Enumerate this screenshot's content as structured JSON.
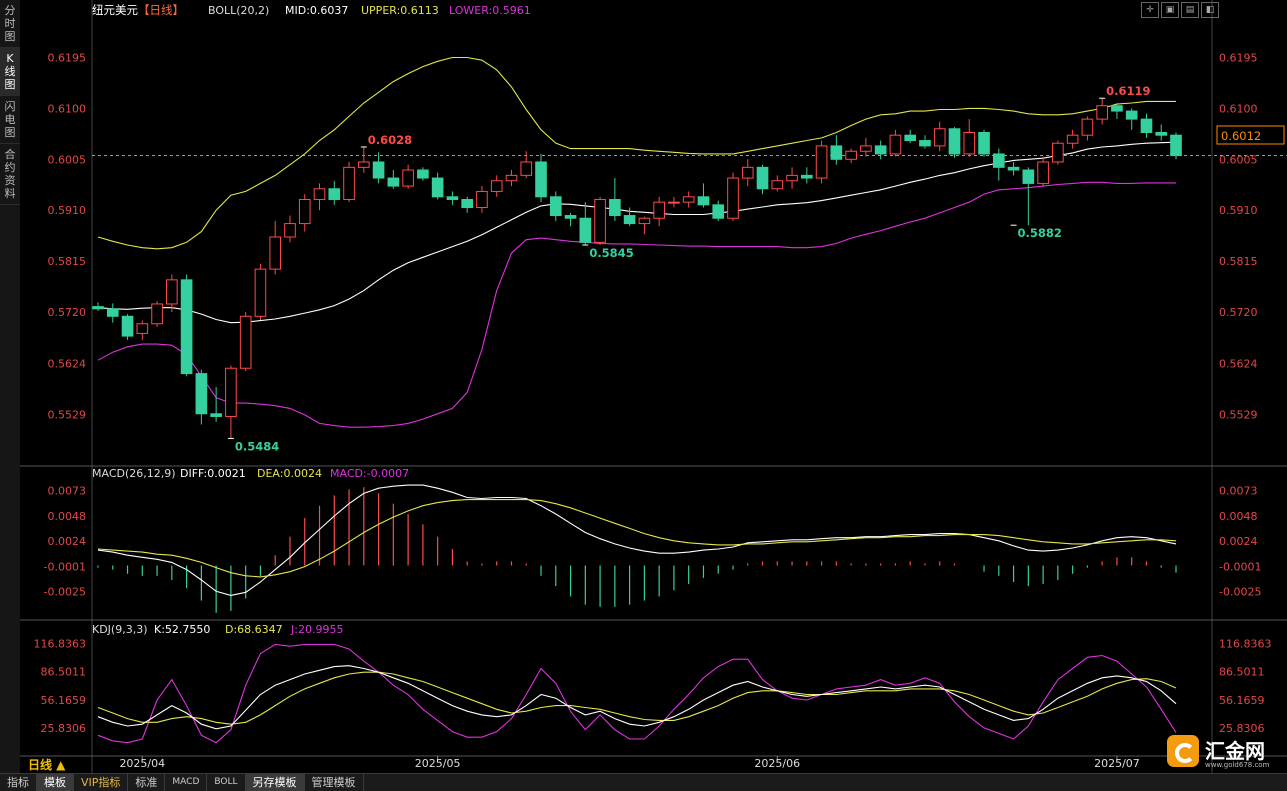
{
  "sidebar": {
    "items": [
      "分时图",
      "K线图",
      "闪电图",
      "合约资料"
    ],
    "active_index": 1
  },
  "header": {
    "symbol": "纽元美元",
    "period_tag": "【日线】",
    "boll_label": "BOLL(20,2)",
    "mid": "MID:0.6037",
    "upper": "UPPER:0.6113",
    "lower": "LOWER:0.5961"
  },
  "macd_header": {
    "name": "MACD(26,12,9)",
    "diff": "DIFF:0.0021",
    "dea": "DEA:0.0024",
    "macd": "MACD:-0.0007"
  },
  "kdj_header": {
    "name": "KDJ(9,3,3)",
    "k": "K:52.7550",
    "d": "D:68.6347",
    "j": "J:20.9955"
  },
  "current_price": "0.6012",
  "period_button": "日线 ▲",
  "bottom_tabs": [
    "指标",
    "模板",
    "VIP指标",
    "标准",
    "MACD",
    "BOLL",
    "另存模板",
    "管理模板"
  ],
  "logo": {
    "name": "汇金网",
    "url": "www.gold678.com"
  },
  "colors": {
    "up": "#ff4a4a",
    "down": "#35d0a0",
    "mid": "#ffffff",
    "upper": "#e5e54a",
    "lower": "#dd33dd",
    "axis_label": "#e04848",
    "dea": "#e5e54a"
  },
  "chart_data": {
    "type": "candlestick",
    "title": "纽元美元 日线",
    "x_ticks": [
      "2025/04",
      "2025/05",
      "2025/06",
      "2025/07"
    ],
    "price_axis": {
      "ticks": [
        0.6195,
        0.61,
        0.6005,
        0.591,
        0.5815,
        0.572,
        0.5624,
        0.5529
      ],
      "range": [
        0.544,
        0.6265
      ]
    },
    "annotations": [
      {
        "label": "0.6028",
        "kind": "high",
        "index": 18,
        "value": 0.6028
      },
      {
        "label": "0.5484",
        "kind": "low",
        "index": 9,
        "value": 0.5484
      },
      {
        "label": "0.5845",
        "kind": "low",
        "index": 33,
        "value": 0.5845
      },
      {
        "label": "0.5882",
        "kind": "low",
        "index": 62,
        "value": 0.5882
      },
      {
        "label": "0.6119",
        "kind": "high",
        "index": 68,
        "value": 0.6119
      }
    ],
    "candles": [
      [
        0.573,
        0.5738,
        0.5722,
        0.5726
      ],
      [
        0.5726,
        0.5736,
        0.57,
        0.5712
      ],
      [
        0.5712,
        0.5716,
        0.5668,
        0.5675
      ],
      [
        0.568,
        0.5704,
        0.5668,
        0.5698
      ],
      [
        0.5698,
        0.574,
        0.5692,
        0.5735
      ],
      [
        0.5735,
        0.579,
        0.572,
        0.578
      ],
      [
        0.578,
        0.579,
        0.56,
        0.5605
      ],
      [
        0.5605,
        0.5612,
        0.551,
        0.553
      ],
      [
        0.553,
        0.558,
        0.5515,
        0.5525
      ],
      [
        0.5525,
        0.562,
        0.5484,
        0.5615
      ],
      [
        0.5615,
        0.572,
        0.561,
        0.5712
      ],
      [
        0.5712,
        0.581,
        0.5705,
        0.58
      ],
      [
        0.58,
        0.589,
        0.579,
        0.586
      ],
      [
        0.586,
        0.59,
        0.585,
        0.5885
      ],
      [
        0.5885,
        0.594,
        0.587,
        0.593
      ],
      [
        0.593,
        0.596,
        0.591,
        0.595
      ],
      [
        0.595,
        0.5965,
        0.592,
        0.593
      ],
      [
        0.593,
        0.6,
        0.5925,
        0.599
      ],
      [
        0.599,
        0.6028,
        0.598,
        0.6
      ],
      [
        0.6,
        0.6018,
        0.596,
        0.597
      ],
      [
        0.597,
        0.5985,
        0.595,
        0.5955
      ],
      [
        0.5955,
        0.5995,
        0.595,
        0.5985
      ],
      [
        0.5985,
        0.599,
        0.5965,
        0.597
      ],
      [
        0.597,
        0.598,
        0.593,
        0.5935
      ],
      [
        0.5935,
        0.5945,
        0.592,
        0.593
      ],
      [
        0.593,
        0.5935,
        0.5905,
        0.5915
      ],
      [
        0.5915,
        0.5955,
        0.5905,
        0.5945
      ],
      [
        0.5945,
        0.5975,
        0.5935,
        0.5965
      ],
      [
        0.5965,
        0.5985,
        0.5955,
        0.5975
      ],
      [
        0.5975,
        0.602,
        0.597,
        0.6
      ],
      [
        0.6,
        0.6015,
        0.5925,
        0.5935
      ],
      [
        0.5935,
        0.5945,
        0.589,
        0.59
      ],
      [
        0.59,
        0.5905,
        0.588,
        0.5895
      ],
      [
        0.5895,
        0.5925,
        0.5845,
        0.585
      ],
      [
        0.585,
        0.5935,
        0.5845,
        0.593
      ],
      [
        0.593,
        0.597,
        0.589,
        0.59
      ],
      [
        0.59,
        0.5915,
        0.588,
        0.5885
      ],
      [
        0.5885,
        0.5898,
        0.5865,
        0.5895
      ],
      [
        0.5895,
        0.5935,
        0.588,
        0.5925
      ],
      [
        0.5925,
        0.5935,
        0.5915,
        0.5925
      ],
      [
        0.5925,
        0.5945,
        0.5915,
        0.5935
      ],
      [
        0.5935,
        0.596,
        0.5915,
        0.592
      ],
      [
        0.592,
        0.5928,
        0.589,
        0.5895
      ],
      [
        0.5895,
        0.598,
        0.589,
        0.597
      ],
      [
        0.597,
        0.6005,
        0.5955,
        0.599
      ],
      [
        0.599,
        0.5995,
        0.594,
        0.595
      ],
      [
        0.595,
        0.5975,
        0.5945,
        0.5965
      ],
      [
        0.5965,
        0.599,
        0.595,
        0.5975
      ],
      [
        0.5975,
        0.599,
        0.596,
        0.597
      ],
      [
        0.597,
        0.604,
        0.596,
        0.603
      ],
      [
        0.603,
        0.605,
        0.5995,
        0.6005
      ],
      [
        0.6005,
        0.6025,
        0.5998,
        0.602
      ],
      [
        0.602,
        0.6045,
        0.601,
        0.603
      ],
      [
        0.603,
        0.604,
        0.6005,
        0.6015
      ],
      [
        0.6015,
        0.606,
        0.601,
        0.605
      ],
      [
        0.605,
        0.606,
        0.6035,
        0.604
      ],
      [
        0.604,
        0.605,
        0.6025,
        0.603
      ],
      [
        0.603,
        0.6075,
        0.602,
        0.6062
      ],
      [
        0.6062,
        0.6065,
        0.6008,
        0.6015
      ],
      [
        0.6015,
        0.608,
        0.601,
        0.6055
      ],
      [
        0.6055,
        0.606,
        0.601,
        0.6015
      ],
      [
        0.6015,
        0.6025,
        0.5965,
        0.599
      ],
      [
        0.599,
        0.6,
        0.5975,
        0.5985
      ],
      [
        0.5985,
        0.599,
        0.5882,
        0.596
      ],
      [
        0.596,
        0.601,
        0.5955,
        0.6
      ],
      [
        0.6,
        0.604,
        0.5995,
        0.6035
      ],
      [
        0.6035,
        0.606,
        0.6025,
        0.605
      ],
      [
        0.605,
        0.6085,
        0.604,
        0.608
      ],
      [
        0.608,
        0.6119,
        0.607,
        0.6105
      ],
      [
        0.6105,
        0.611,
        0.608,
        0.6095
      ],
      [
        0.6095,
        0.61,
        0.606,
        0.608
      ],
      [
        0.608,
        0.609,
        0.6045,
        0.6055
      ],
      [
        0.6055,
        0.607,
        0.604,
        0.605
      ],
      [
        0.605,
        0.6055,
        0.6005,
        0.6012
      ]
    ],
    "boll": {
      "mid": [
        0.5728,
        0.5726,
        0.5725,
        0.5727,
        0.5728,
        0.5728,
        0.5724,
        0.5716,
        0.5706,
        0.57,
        0.5701,
        0.5704,
        0.5707,
        0.5712,
        0.5718,
        0.5724,
        0.5732,
        0.5744,
        0.576,
        0.578,
        0.5798,
        0.5812,
        0.5822,
        0.5832,
        0.5842,
        0.5852,
        0.5864,
        0.5878,
        0.5892,
        0.5906,
        0.5918,
        0.5922,
        0.5921,
        0.5918,
        0.5915,
        0.5912,
        0.5908,
        0.5906,
        0.5904,
        0.5902,
        0.5902,
        0.5902,
        0.5905,
        0.5908,
        0.5912,
        0.5916,
        0.592,
        0.5922,
        0.5924,
        0.5928,
        0.5933,
        0.5938,
        0.5943,
        0.5948,
        0.5955,
        0.5962,
        0.5968,
        0.5975,
        0.598,
        0.5987,
        0.5993,
        0.5998,
        0.6003,
        0.6005,
        0.6007,
        0.6012,
        0.6017,
        0.6024,
        0.6028,
        0.603,
        0.6033,
        0.6035,
        0.6036,
        0.6037
      ],
      "upper": [
        0.586,
        0.5852,
        0.5845,
        0.584,
        0.5838,
        0.584,
        0.585,
        0.587,
        0.591,
        0.5938,
        0.5945,
        0.596,
        0.5975,
        0.5995,
        0.6015,
        0.604,
        0.606,
        0.6085,
        0.611,
        0.613,
        0.615,
        0.6165,
        0.6178,
        0.6188,
        0.6195,
        0.6195,
        0.619,
        0.6172,
        0.614,
        0.6098,
        0.606,
        0.6035,
        0.6025,
        0.6025,
        0.6025,
        0.6025,
        0.6025,
        0.6022,
        0.602,
        0.6018,
        0.6016,
        0.6015,
        0.6015,
        0.6015,
        0.602,
        0.6025,
        0.603,
        0.6035,
        0.604,
        0.6045,
        0.6055,
        0.6068,
        0.608,
        0.6088,
        0.609,
        0.6095,
        0.6095,
        0.6098,
        0.6098,
        0.61,
        0.61,
        0.6098,
        0.6095,
        0.609,
        0.6088,
        0.6088,
        0.609,
        0.6095,
        0.61,
        0.6108,
        0.611,
        0.6113,
        0.6113,
        0.6113
      ],
      "lower": [
        0.563,
        0.5645,
        0.5655,
        0.566,
        0.566,
        0.5658,
        0.564,
        0.56,
        0.556,
        0.555,
        0.555,
        0.5548,
        0.5545,
        0.554,
        0.5528,
        0.5512,
        0.5508,
        0.5505,
        0.5505,
        0.5506,
        0.5508,
        0.5512,
        0.552,
        0.553,
        0.554,
        0.557,
        0.565,
        0.576,
        0.583,
        0.5855,
        0.5858,
        0.5855,
        0.5852,
        0.585,
        0.5848,
        0.5847,
        0.5847,
        0.5846,
        0.5845,
        0.5844,
        0.5843,
        0.5843,
        0.5842,
        0.5842,
        0.5842,
        0.5842,
        0.5842,
        0.584,
        0.584,
        0.5842,
        0.5848,
        0.5858,
        0.5865,
        0.5872,
        0.588,
        0.5888,
        0.5895,
        0.5905,
        0.5915,
        0.5925,
        0.594,
        0.5948,
        0.595,
        0.5952,
        0.5955,
        0.5958,
        0.596,
        0.5962,
        0.5962,
        0.596,
        0.596,
        0.5961,
        0.5961,
        0.5961
      ]
    },
    "macd": {
      "y_ticks": [
        0.0073,
        0.0048,
        0.0024,
        -0.0001,
        -0.0025
      ],
      "range": [
        -0.0048,
        0.0082
      ],
      "diff": [
        0.0015,
        0.0013,
        0.001,
        0.0008,
        0.0006,
        0.0003,
        -0.0004,
        -0.0014,
        -0.0025,
        -0.0029,
        -0.0026,
        -0.0016,
        -0.0004,
        0.0008,
        0.0022,
        0.0035,
        0.0048,
        0.006,
        0.007,
        0.0075,
        0.0077,
        0.0078,
        0.0078,
        0.0075,
        0.0071,
        0.0066,
        0.0065,
        0.0066,
        0.0066,
        0.0065,
        0.0058,
        0.005,
        0.0041,
        0.0032,
        0.0026,
        0.0021,
        0.0017,
        0.0014,
        0.0012,
        0.0012,
        0.0013,
        0.0015,
        0.0016,
        0.0018,
        0.0022,
        0.0023,
        0.0024,
        0.0025,
        0.0025,
        0.0026,
        0.0027,
        0.0027,
        0.0028,
        0.0028,
        0.0029,
        0.003,
        0.003,
        0.0031,
        0.0031,
        0.003,
        0.0027,
        0.0024,
        0.0019,
        0.0015,
        0.0014,
        0.0015,
        0.0017,
        0.002,
        0.0024,
        0.0027,
        0.0028,
        0.0027,
        0.0024,
        0.0021
      ],
      "dea": [
        0.0016,
        0.0015,
        0.0014,
        0.0013,
        0.0011,
        0.001,
        0.0007,
        0.0003,
        -0.0002,
        -0.0007,
        -0.001,
        -0.0011,
        -0.0009,
        -0.0006,
        -0.0001,
        0.0006,
        0.0014,
        0.0023,
        0.0032,
        0.004,
        0.0047,
        0.0053,
        0.0058,
        0.0061,
        0.0063,
        0.0064,
        0.0064,
        0.0064,
        0.0064,
        0.0064,
        0.0063,
        0.006,
        0.0056,
        0.0051,
        0.0046,
        0.0041,
        0.0036,
        0.0031,
        0.0027,
        0.0024,
        0.0022,
        0.0021,
        0.002,
        0.002,
        0.0021,
        0.0021,
        0.0022,
        0.0023,
        0.0023,
        0.0024,
        0.0025,
        0.0026,
        0.0027,
        0.0027,
        0.0028,
        0.0028,
        0.0029,
        0.0029,
        0.003,
        0.003,
        0.003,
        0.0029,
        0.0027,
        0.0025,
        0.0023,
        0.0022,
        0.0021,
        0.0021,
        0.0022,
        0.0023,
        0.0024,
        0.0025,
        0.0025,
        0.0024
      ],
      "hist": [
        -0.0002,
        -0.0004,
        -0.0008,
        -0.001,
        -0.001,
        -0.0014,
        -0.0022,
        -0.0034,
        -0.0046,
        -0.0044,
        -0.0032,
        -0.001,
        0.001,
        0.0028,
        0.0046,
        0.0058,
        0.0068,
        0.0074,
        0.0076,
        0.007,
        0.006,
        0.005,
        0.004,
        0.0028,
        0.0016,
        0.0004,
        0.0002,
        0.0004,
        0.0004,
        0.0002,
        -0.001,
        -0.002,
        -0.003,
        -0.0038,
        -0.004,
        -0.004,
        -0.0038,
        -0.0034,
        -0.003,
        -0.0024,
        -0.0018,
        -0.0012,
        -0.0008,
        -0.0004,
        0.0002,
        0.0004,
        0.0004,
        0.0004,
        0.0004,
        0.0004,
        0.0004,
        0.0002,
        0.0002,
        0.0002,
        0.0002,
        0.0004,
        0.0002,
        0.0004,
        0.0002,
        0.0,
        -0.0006,
        -0.001,
        -0.0016,
        -0.002,
        -0.0018,
        -0.0014,
        -0.0008,
        -0.0002,
        0.0004,
        0.0008,
        0.0008,
        0.0004,
        -0.0002,
        -0.0007
      ]
    },
    "kdj": {
      "y_ticks": [
        116.8363,
        86.5011,
        56.1659,
        25.8306
      ],
      "range": [
        0,
        125
      ],
      "k": [
        38,
        32,
        28,
        30,
        40,
        50,
        42,
        30,
        25,
        28,
        45,
        62,
        72,
        78,
        84,
        88,
        92,
        93,
        90,
        86,
        80,
        74,
        66,
        58,
        50,
        44,
        40,
        38,
        40,
        50,
        62,
        58,
        48,
        40,
        44,
        36,
        30,
        28,
        32,
        38,
        46,
        56,
        64,
        72,
        76,
        70,
        66,
        62,
        60,
        62,
        64,
        66,
        68,
        70,
        68,
        70,
        72,
        70,
        62,
        54,
        46,
        40,
        34,
        36,
        46,
        58,
        66,
        74,
        80,
        82,
        80,
        76,
        66,
        52
      ],
      "d": [
        48,
        42,
        36,
        32,
        32,
        36,
        38,
        36,
        32,
        30,
        32,
        40,
        50,
        60,
        68,
        74,
        80,
        84,
        86,
        86,
        84,
        80,
        76,
        70,
        64,
        58,
        52,
        46,
        42,
        44,
        48,
        50,
        50,
        48,
        46,
        42,
        38,
        35,
        34,
        34,
        38,
        44,
        50,
        58,
        64,
        66,
        66,
        64,
        62,
        62,
        62,
        64,
        66,
        66,
        66,
        68,
        68,
        68,
        66,
        62,
        56,
        50,
        44,
        40,
        42,
        48,
        54,
        60,
        68,
        74,
        78,
        79,
        76,
        69
      ],
      "j": [
        18,
        12,
        10,
        14,
        56,
        78,
        50,
        18,
        10,
        24,
        72,
        106,
        116,
        114,
        116,
        116,
        116,
        111,
        98,
        86,
        72,
        62,
        46,
        34,
        22,
        16,
        16,
        22,
        36,
        62,
        90,
        74,
        44,
        24,
        40,
        24,
        14,
        14,
        28,
        46,
        62,
        80,
        92,
        100,
        100,
        78,
        66,
        58,
        56,
        62,
        68,
        70,
        72,
        78,
        72,
        74,
        80,
        74,
        54,
        38,
        26,
        20,
        14,
        28,
        54,
        78,
        90,
        102,
        104,
        98,
        84,
        70,
        46,
        21
      ]
    }
  }
}
